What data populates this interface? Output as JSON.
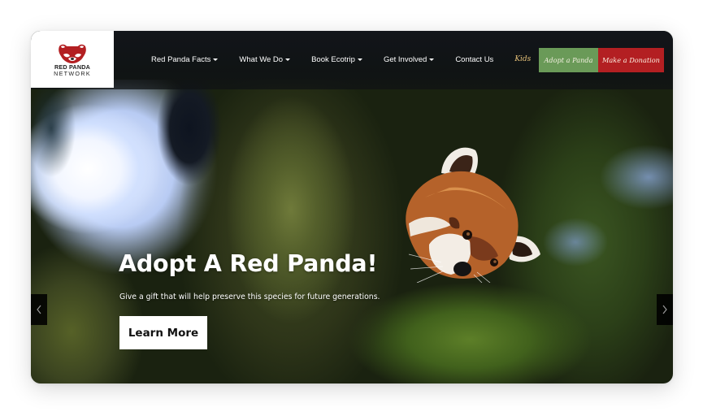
{
  "brand": {
    "name_line1": "RED PANDA",
    "name_line2": "NETWORK",
    "logo_icon": "red-panda-face-icon",
    "logo_color": "#b31f22"
  },
  "nav": {
    "items": [
      {
        "label": "Red Panda Facts",
        "has_dropdown": true
      },
      {
        "label": "What We Do",
        "has_dropdown": true
      },
      {
        "label": "Book Ecotrip",
        "has_dropdown": true
      },
      {
        "label": "Get Involved",
        "has_dropdown": true
      },
      {
        "label": "Contact Us",
        "has_dropdown": false
      }
    ],
    "kids_label": "Kids",
    "kids_color": "#e8c37a"
  },
  "cta": {
    "adopt_label": "Adopt a Panda",
    "adopt_color": "#6a9a58",
    "donate_label": "Make a Donation",
    "donate_color": "#b31f22"
  },
  "hero": {
    "title": "Adopt A Red Panda!",
    "subtitle": "Give a gift that will help preserve this species for future generations.",
    "button_label": "Learn More",
    "image_description": "red-panda-peeking-from-mossy-tree",
    "prev_icon": "chevron-left-icon",
    "next_icon": "chevron-right-icon"
  }
}
